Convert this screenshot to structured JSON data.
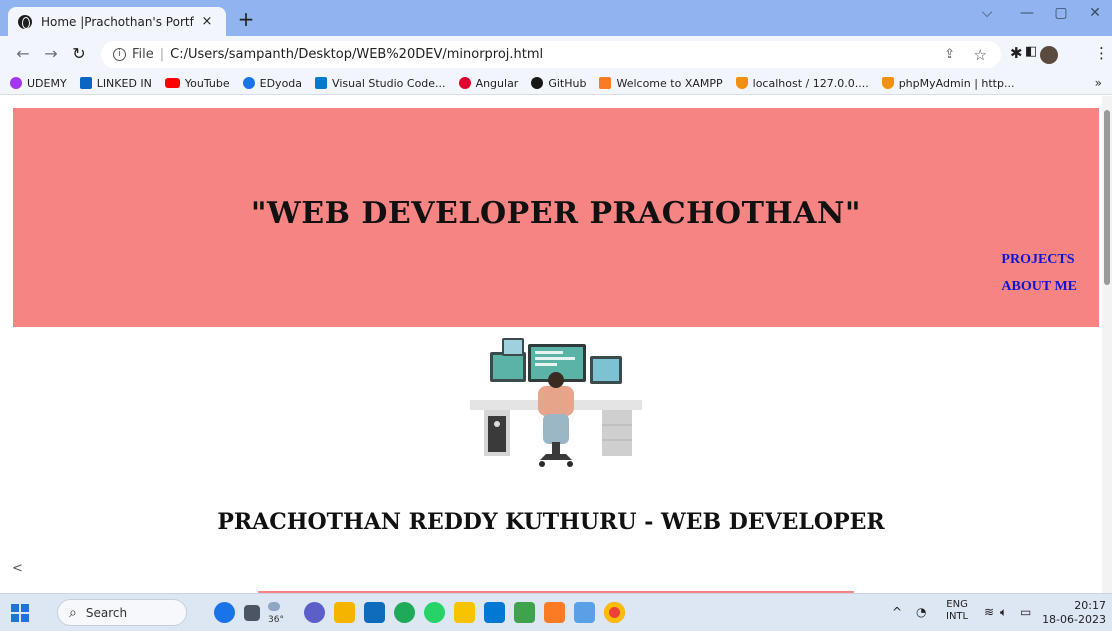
{
  "browser": {
    "tab_title": "Home |Prachothan's Portfolio",
    "tab_close": "×",
    "new_tab": "+",
    "window_controls": {
      "minimize": "—",
      "maximize": "▢",
      "close": "✕",
      "menu": "⌵"
    },
    "url_scheme": "File",
    "url_separator": "|",
    "url": "C:/Users/sampanth/Desktop/WEB%20DEV/minorproj.html",
    "bookmarks": [
      {
        "label": "UDEMY",
        "color": "#a435f0"
      },
      {
        "label": "LINKED IN",
        "color": "#0a66c2"
      },
      {
        "label": "YouTube",
        "color": "#ff0000"
      },
      {
        "label": "EDyoda",
        "color": "#1a73e8"
      },
      {
        "label": "Visual Studio Code...",
        "color": "#007acc"
      },
      {
        "label": "Angular",
        "color": "#dd0031"
      },
      {
        "label": "GitHub",
        "color": "#181717"
      },
      {
        "label": "Welcome to XAMPP",
        "color": "#fb7a24"
      },
      {
        "label": "localhost / 127.0.0....",
        "color": "#f29111"
      },
      {
        "label": "phpMyAdmin | http...",
        "color": "#f29111"
      }
    ],
    "bookmarks_more": "»"
  },
  "page": {
    "hero_title": "\"WEB DEVELOPER PRACHOTHAN\"",
    "nav": {
      "projects": "PROJECTS",
      "about": "ABOUT ME"
    },
    "subtitle": "PRACHOTHAN REDDY KUTHURU - WEB DEVELOPER",
    "angle_text": "<",
    "colors": {
      "hero_bg": "#f68482",
      "link": "#0e16d6"
    }
  },
  "taskbar": {
    "search_placeholder": "Search",
    "weather": "36°",
    "lang_top": "ENG",
    "lang_bottom": "INTL",
    "time": "20:17",
    "date": "18-06-2023"
  }
}
